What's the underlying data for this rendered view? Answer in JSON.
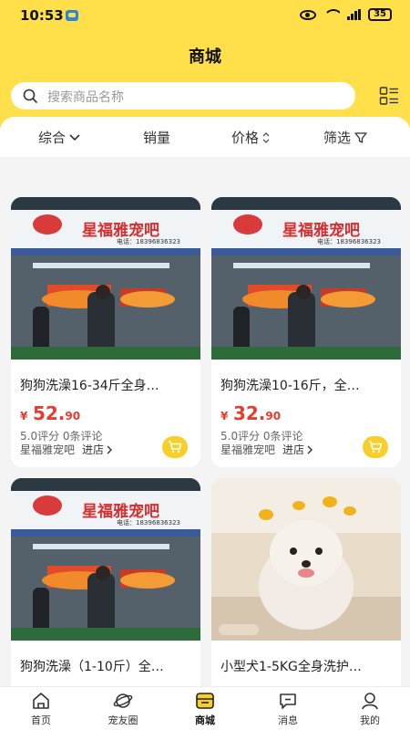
{
  "status_bar": {
    "time": "10:53",
    "battery": "35"
  },
  "page_title": "商城",
  "search": {
    "placeholder": "搜索商品名称"
  },
  "filters": [
    {
      "label": "综合"
    },
    {
      "label": "销量"
    },
    {
      "label": "价格"
    },
    {
      "label": "筛选"
    }
  ],
  "products": [
    {
      "title": "狗狗洗澡16-34斤全身…",
      "currency": "¥",
      "price_int": "52.",
      "price_dec": "90",
      "rating": "5.0评分 0条评论",
      "store": "星福雅宠吧",
      "store_link": "进店",
      "sign_text": "星福雅宠吧",
      "sign_phone": "电话：18396836323"
    },
    {
      "title": "狗狗洗澡10-16斤，全…",
      "currency": "¥",
      "price_int": "32.",
      "price_dec": "90",
      "rating": "5.0评分 0条评论",
      "store": "星福雅宠吧",
      "store_link": "进店",
      "sign_text": "星福雅宠吧",
      "sign_phone": "电话：18396836323"
    },
    {
      "title": "狗狗洗澡（1-10斤）全…",
      "sign_text": "星福雅宠吧",
      "sign_phone": "电话：18396836323"
    },
    {
      "title": "小型犬1-5KG全身洗护…"
    }
  ],
  "tabbar": [
    {
      "label": "首页"
    },
    {
      "label": "宠友圈"
    },
    {
      "label": "商城"
    },
    {
      "label": "消息"
    },
    {
      "label": "我的"
    }
  ],
  "colors": {
    "brand_yellow": "#ffe04a",
    "price_red": "#e63b2e",
    "cart_yellow": "#f8cf2a"
  }
}
